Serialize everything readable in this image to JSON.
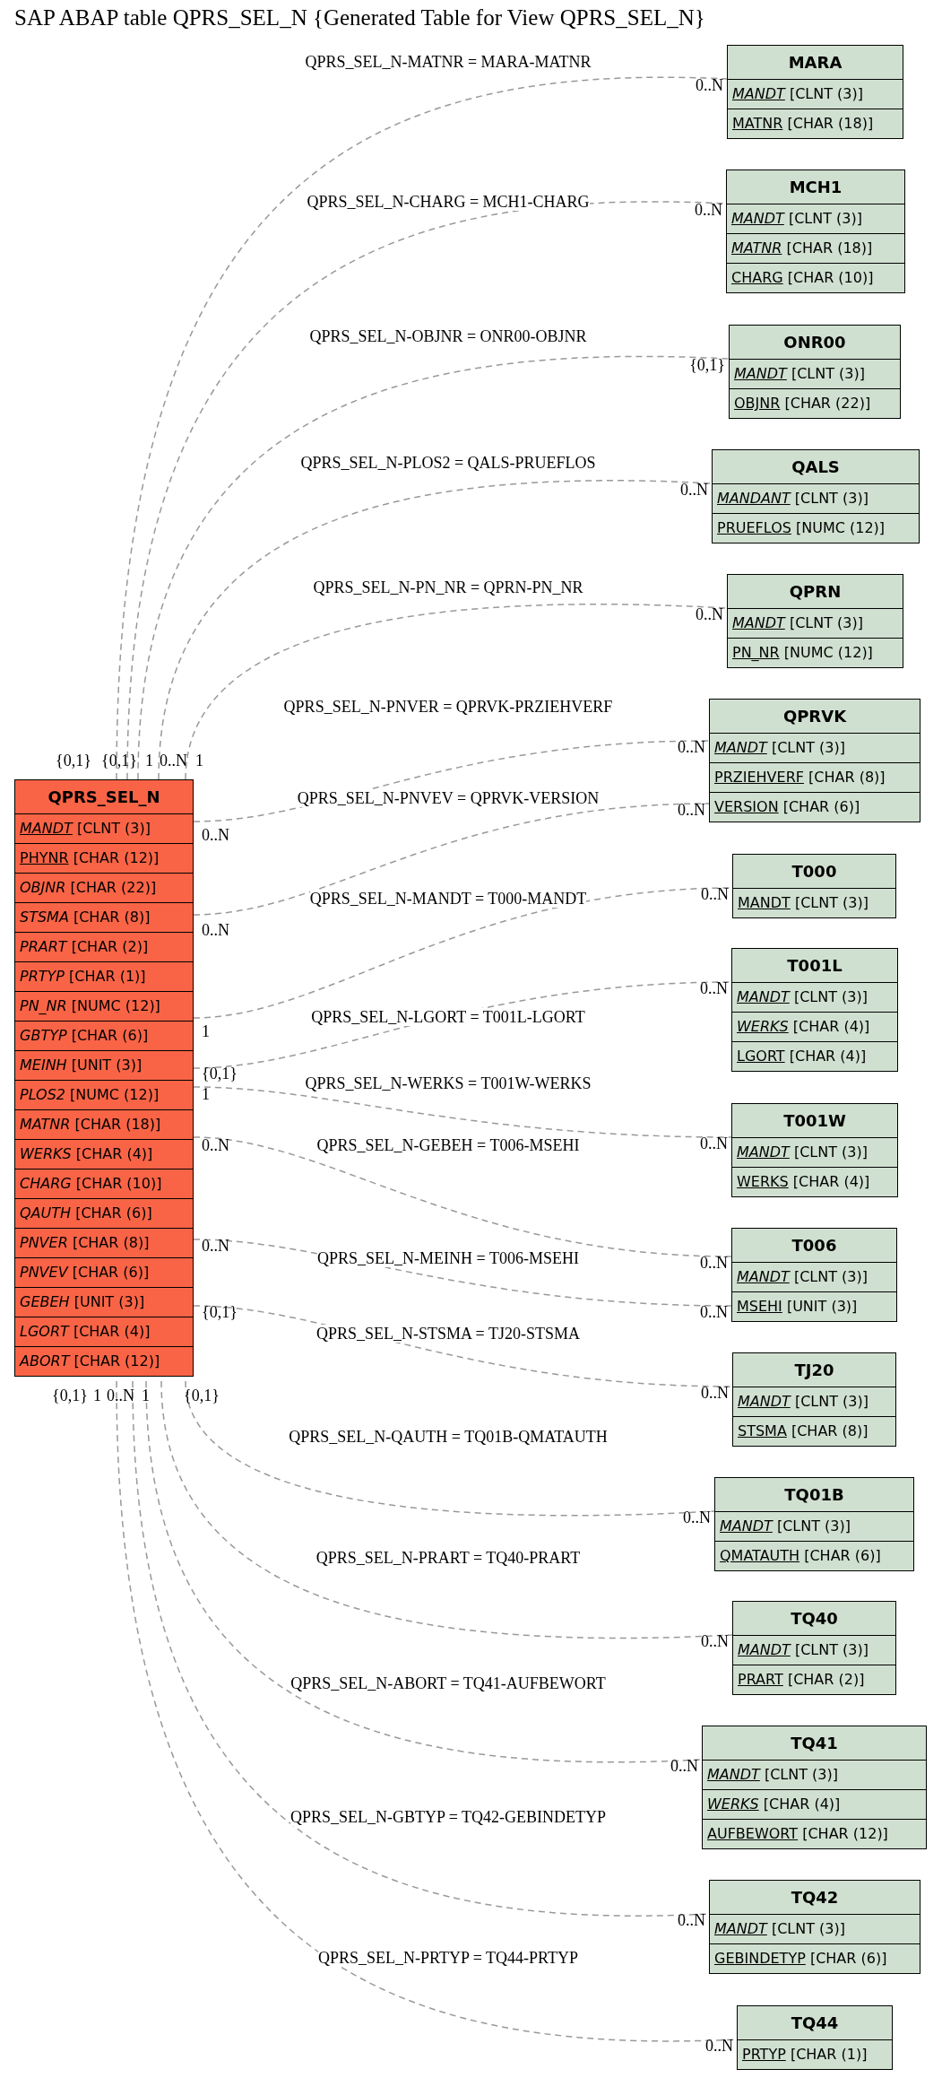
{
  "title": "SAP ABAP table QPRS_SEL_N {Generated Table for View QPRS_SEL_N}",
  "main_table": {
    "name": "QPRS_SEL_N",
    "fields": [
      {
        "name": "MANDT",
        "type": "[CLNT (3)]",
        "key": true,
        "italic": true
      },
      {
        "name": "PHYNR",
        "type": "[CHAR (12)]",
        "key": true,
        "italic": false
      },
      {
        "name": "OBJNR",
        "type": "[CHAR (22)]",
        "key": false,
        "italic": true
      },
      {
        "name": "STSMA",
        "type": "[CHAR (8)]",
        "key": false,
        "italic": true
      },
      {
        "name": "PRART",
        "type": "[CHAR (2)]",
        "key": false,
        "italic": true
      },
      {
        "name": "PRTYP",
        "type": "[CHAR (1)]",
        "key": false,
        "italic": true
      },
      {
        "name": "PN_NR",
        "type": "[NUMC (12)]",
        "key": false,
        "italic": true
      },
      {
        "name": "GBTYP",
        "type": "[CHAR (6)]",
        "key": false,
        "italic": true
      },
      {
        "name": "MEINH",
        "type": "[UNIT (3)]",
        "key": false,
        "italic": true
      },
      {
        "name": "PLOS2",
        "type": "[NUMC (12)]",
        "key": false,
        "italic": true
      },
      {
        "name": "MATNR",
        "type": "[CHAR (18)]",
        "key": false,
        "italic": true
      },
      {
        "name": "WERKS",
        "type": "[CHAR (4)]",
        "key": false,
        "italic": true
      },
      {
        "name": "CHARG",
        "type": "[CHAR (10)]",
        "key": false,
        "italic": true
      },
      {
        "name": "QAUTH",
        "type": "[CHAR (6)]",
        "key": false,
        "italic": true
      },
      {
        "name": "PNVER",
        "type": "[CHAR (8)]",
        "key": false,
        "italic": true
      },
      {
        "name": "PNVEV",
        "type": "[CHAR (6)]",
        "key": false,
        "italic": true
      },
      {
        "name": "GEBEH",
        "type": "[UNIT (3)]",
        "key": false,
        "italic": true
      },
      {
        "name": "LGORT",
        "type": "[CHAR (4)]",
        "key": false,
        "italic": true
      },
      {
        "name": "ABORT",
        "type": "[CHAR (12)]",
        "key": false,
        "italic": true
      }
    ]
  },
  "tables": [
    {
      "name": "MARA",
      "fields": [
        {
          "name": "MANDT",
          "type": "[CLNT (3)]",
          "key": true,
          "italic": true
        },
        {
          "name": "MATNR",
          "type": "[CHAR (18)]",
          "key": true,
          "italic": false
        }
      ],
      "relations": [
        {
          "label": "QPRS_SEL_N-MATNR = MARA-MATNR",
          "from_card": "{0,1}",
          "to_card": "0..N"
        }
      ]
    },
    {
      "name": "MCH1",
      "fields": [
        {
          "name": "MANDT",
          "type": "[CLNT (3)]",
          "key": true,
          "italic": true
        },
        {
          "name": "MATNR",
          "type": "[CHAR (18)]",
          "key": true,
          "italic": true
        },
        {
          "name": "CHARG",
          "type": "[CHAR (10)]",
          "key": true,
          "italic": false
        }
      ],
      "relations": [
        {
          "label": "QPRS_SEL_N-CHARG = MCH1-CHARG",
          "from_card": "{0,1}",
          "to_card": "0..N"
        }
      ]
    },
    {
      "name": "ONR00",
      "fields": [
        {
          "name": "MANDT",
          "type": "[CLNT (3)]",
          "key": true,
          "italic": true
        },
        {
          "name": "OBJNR",
          "type": "[CHAR (22)]",
          "key": true,
          "italic": false
        }
      ],
      "relations": [
        {
          "label": "QPRS_SEL_N-OBJNR = ONR00-OBJNR",
          "from_card": "1",
          "to_card": "{0,1}"
        }
      ]
    },
    {
      "name": "QALS",
      "fields": [
        {
          "name": "MANDANT",
          "type": "[CLNT (3)]",
          "key": true,
          "italic": true
        },
        {
          "name": "PRUEFLOS",
          "type": "[NUMC (12)]",
          "key": true,
          "italic": false
        }
      ],
      "relations": [
        {
          "label": "QPRS_SEL_N-PLOS2 = QALS-PRUEFLOS",
          "from_card": "0..N",
          "to_card": "0..N"
        }
      ]
    },
    {
      "name": "QPRN",
      "fields": [
        {
          "name": "MANDT",
          "type": "[CLNT (3)]",
          "key": true,
          "italic": true
        },
        {
          "name": "PN_NR",
          "type": "[NUMC (12)]",
          "key": true,
          "italic": false
        }
      ],
      "relations": [
        {
          "label": "QPRS_SEL_N-PN_NR = QPRN-PN_NR",
          "from_card": "1",
          "to_card": "0..N"
        }
      ]
    },
    {
      "name": "QPRVK",
      "fields": [
        {
          "name": "MANDT",
          "type": "[CLNT (3)]",
          "key": true,
          "italic": true
        },
        {
          "name": "PRZIEHVERF",
          "type": "[CHAR (8)]",
          "key": true,
          "italic": false
        },
        {
          "name": "VERSION",
          "type": "[CHAR (6)]",
          "key": true,
          "italic": false
        }
      ],
      "relations": [
        {
          "label": "QPRS_SEL_N-PNVER = QPRVK-PRZIEHVERF",
          "from_card": "0..N",
          "to_card": "0..N"
        },
        {
          "label": "QPRS_SEL_N-PNVEV = QPRVK-VERSION",
          "from_card": "0..N",
          "to_card": "0..N"
        }
      ]
    },
    {
      "name": "T000",
      "fields": [
        {
          "name": "MANDT",
          "type": "[CLNT (3)]",
          "key": true,
          "italic": false
        }
      ],
      "relations": [
        {
          "label": "QPRS_SEL_N-MANDT = T000-MANDT",
          "from_card": "1",
          "to_card": "0..N"
        }
      ]
    },
    {
      "name": "T001L",
      "fields": [
        {
          "name": "MANDT",
          "type": "[CLNT (3)]",
          "key": true,
          "italic": true
        },
        {
          "name": "WERKS",
          "type": "[CHAR (4)]",
          "key": true,
          "italic": true
        },
        {
          "name": "LGORT",
          "type": "[CHAR (4)]",
          "key": true,
          "italic": false
        }
      ],
      "relations": [
        {
          "label": "QPRS_SEL_N-LGORT = T001L-LGORT",
          "from_card": "{0,1}",
          "to_card": "0..N"
        }
      ]
    },
    {
      "name": "T001W",
      "fields": [
        {
          "name": "MANDT",
          "type": "[CLNT (3)]",
          "key": true,
          "italic": true
        },
        {
          "name": "WERKS",
          "type": "[CHAR (4)]",
          "key": true,
          "italic": false
        }
      ],
      "relations": [
        {
          "label": "QPRS_SEL_N-WERKS = T001W-WERKS",
          "from_card": "1",
          "to_card": "0..N"
        }
      ]
    },
    {
      "name": "T006",
      "fields": [
        {
          "name": "MANDT",
          "type": "[CLNT (3)]",
          "key": true,
          "italic": true
        },
        {
          "name": "MSEHI",
          "type": "[UNIT (3)]",
          "key": true,
          "italic": false
        }
      ],
      "relations": [
        {
          "label": "QPRS_SEL_N-GEBEH = T006-MSEHI",
          "from_card": "0..N",
          "to_card": "0..N"
        },
        {
          "label": "QPRS_SEL_N-MEINH = T006-MSEHI",
          "from_card": "0..N",
          "to_card": "0..N"
        }
      ]
    },
    {
      "name": "TJ20",
      "fields": [
        {
          "name": "MANDT",
          "type": "[CLNT (3)]",
          "key": true,
          "italic": true
        },
        {
          "name": "STSMA",
          "type": "[CHAR (8)]",
          "key": true,
          "italic": false
        }
      ],
      "relations": [
        {
          "label": "QPRS_SEL_N-STSMA = TJ20-STSMA",
          "from_card": "{0,1}",
          "to_card": "0..N"
        }
      ]
    },
    {
      "name": "TQ01B",
      "fields": [
        {
          "name": "MANDT",
          "type": "[CLNT (3)]",
          "key": true,
          "italic": true
        },
        {
          "name": "QMATAUTH",
          "type": "[CHAR (6)]",
          "key": true,
          "italic": false
        }
      ],
      "relations": [
        {
          "label": "QPRS_SEL_N-QAUTH = TQ01B-QMATAUTH",
          "from_card": "{0,1}",
          "to_card": "0..N"
        }
      ]
    },
    {
      "name": "TQ40",
      "fields": [
        {
          "name": "MANDT",
          "type": "[CLNT (3)]",
          "key": true,
          "italic": true
        },
        {
          "name": "PRART",
          "type": "[CHAR (2)]",
          "key": true,
          "italic": false
        }
      ],
      "relations": [
        {
          "label": "QPRS_SEL_N-PRART = TQ40-PRART",
          "from_card": "1",
          "to_card": "0..N"
        }
      ]
    },
    {
      "name": "TQ41",
      "fields": [
        {
          "name": "MANDT",
          "type": "[CLNT (3)]",
          "key": true,
          "italic": true
        },
        {
          "name": "WERKS",
          "type": "[CHAR (4)]",
          "key": true,
          "italic": true
        },
        {
          "name": "AUFBEWORT",
          "type": "[CHAR (12)]",
          "key": true,
          "italic": false
        }
      ],
      "relations": [
        {
          "label": "QPRS_SEL_N-ABORT = TQ41-AUFBEWORT",
          "from_card": "0..N",
          "to_card": "0..N"
        }
      ]
    },
    {
      "name": "TQ42",
      "fields": [
        {
          "name": "MANDT",
          "type": "[CLNT (3)]",
          "key": true,
          "italic": true
        },
        {
          "name": "GEBINDETYP",
          "type": "[CHAR (6)]",
          "key": true,
          "italic": false
        }
      ],
      "relations": [
        {
          "label": "QPRS_SEL_N-GBTYP = TQ42-GEBINDETYP",
          "from_card": "1",
          "to_card": "0..N"
        }
      ]
    },
    {
      "name": "TQ44",
      "fields": [
        {
          "name": "PRTYP",
          "type": "[CHAR (1)]",
          "key": true,
          "italic": false
        }
      ],
      "relations": [
        {
          "label": "QPRS_SEL_N-PRTYP = TQ44-PRTYP",
          "from_card": "{0,1}",
          "to_card": "0..N"
        }
      ]
    }
  ]
}
